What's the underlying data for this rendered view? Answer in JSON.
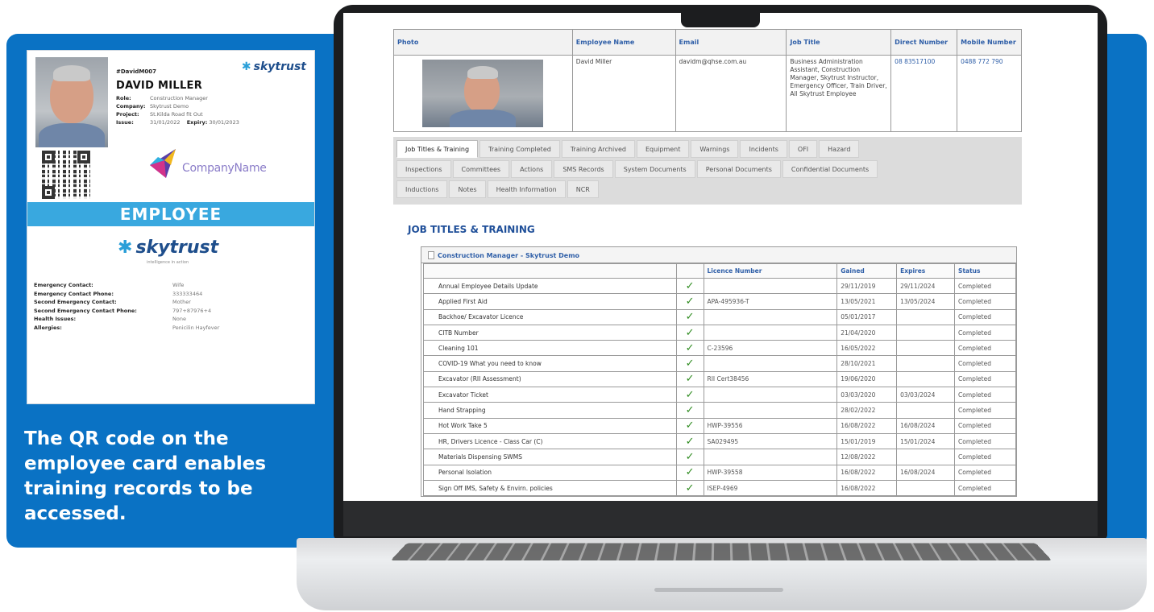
{
  "caption": "The QR code on the employee card enables training records to be accessed.",
  "colors": {
    "panel": "#0a72c4",
    "band": "#39a8df",
    "link": "#2f5fa8",
    "tick": "#2e8b1f"
  },
  "card": {
    "employee_id": "#DavidM007",
    "name": "DAVID MILLER",
    "brand": "skytrust",
    "fields": [
      {
        "label": "Role:",
        "value": "Construction Manager"
      },
      {
        "label": "Company:",
        "value": "Skytrust Demo"
      },
      {
        "label": "Project:",
        "value": "St.Kilda Road fit Out"
      }
    ],
    "issue_label": "Issue:",
    "issue": "31/01/2022",
    "expiry_label": "Expiry:",
    "expiry": "30/01/2023",
    "company_name": "CompanyName",
    "band_text": "EMPLOYEE",
    "brand_tagline": "intelligence in action",
    "emergency": [
      {
        "label": "Emergency Contact:",
        "value": "Wife"
      },
      {
        "label": "Emergency Contact Phone:",
        "value": "333333464"
      },
      {
        "label": "Second Emergency Contact:",
        "value": "Mother"
      },
      {
        "label": "Second Emergency Contact Phone:",
        "value": "797+87976+4"
      },
      {
        "label": "Health Issues:",
        "value": "None"
      },
      {
        "label": "Allergies:",
        "value": "Penicilin Hayfever"
      }
    ]
  },
  "employee_table": {
    "headers": [
      "Photo",
      "Employee Name",
      "Email",
      "Job Title",
      "Direct Number",
      "Mobile Number"
    ],
    "row": {
      "name": "David Miller",
      "email": "davidm@qhse.com.au",
      "job_title": "Business Administration Assistant, Construction Manager, Skytrust Instructor, Emergency Officer, Train Driver, All Skytrust Employee",
      "direct": "08 83517100",
      "mobile": "0488 772 790"
    }
  },
  "tabs": {
    "row1": [
      "Job Titles & Training",
      "Training Completed",
      "Training Archived",
      "Equipment",
      "Warnings",
      "Incidents",
      "OFI",
      "Hazard"
    ],
    "row2": [
      "Inspections",
      "Committees",
      "Actions",
      "SMS Records",
      "System Documents",
      "Personal Documents",
      "Confidential Documents"
    ],
    "row3": [
      "Inductions",
      "Notes",
      "Health Information",
      "NCR"
    ],
    "active": "Job Titles & Training"
  },
  "section_title": "JOB TITLES & TRAINING",
  "training": {
    "group_title": "Construction Manager - Skytrust Demo",
    "headers": [
      "",
      "",
      "Licence Number",
      "Gained",
      "Expires",
      "Status"
    ],
    "tick": "✓",
    "rows": [
      {
        "course": "Annual Employee Details Update",
        "licence": "",
        "gained": "29/11/2019",
        "expires": "29/11/2024",
        "status": "Completed"
      },
      {
        "course": "Applied First Aid",
        "licence": "APA-495936-T",
        "gained": "13/05/2021",
        "expires": "13/05/2024",
        "status": "Completed"
      },
      {
        "course": "Backhoe/ Excavator Licence",
        "licence": "",
        "gained": "05/01/2017",
        "expires": "",
        "status": "Completed"
      },
      {
        "course": "CITB Number",
        "licence": "",
        "gained": "21/04/2020",
        "expires": "",
        "status": "Completed"
      },
      {
        "course": "Cleaning 101",
        "licence": "C-23596",
        "gained": "16/05/2022",
        "expires": "",
        "status": "Completed"
      },
      {
        "course": "COVID-19 What you need to know",
        "licence": "",
        "gained": "28/10/2021",
        "expires": "",
        "status": "Completed"
      },
      {
        "course": "Excavator (RII Assessment)",
        "licence": "RII Cert38456",
        "gained": "19/06/2020",
        "expires": "",
        "status": "Completed"
      },
      {
        "course": "Excavator Ticket",
        "licence": "",
        "gained": "03/03/2020",
        "expires": "03/03/2024",
        "status": "Completed"
      },
      {
        "course": "Hand Strapping",
        "licence": "",
        "gained": "28/02/2022",
        "expires": "",
        "status": "Completed"
      },
      {
        "course": "Hot Work Take 5",
        "licence": "HWP-39556",
        "gained": "16/08/2022",
        "expires": "16/08/2024",
        "status": "Completed"
      },
      {
        "course": "HR, Drivers Licence - Class Car (C)",
        "licence": "SA029495",
        "gained": "15/01/2019",
        "expires": "15/01/2024",
        "status": "Completed"
      },
      {
        "course": "Materials Dispensing SWMS",
        "licence": "",
        "gained": "12/08/2022",
        "expires": "",
        "status": "Completed"
      },
      {
        "course": "Personal Isolation",
        "licence": "HWP-39558",
        "gained": "16/08/2022",
        "expires": "16/08/2024",
        "status": "Completed"
      },
      {
        "course": "Sign Off IMS, Safety & Envirn. policies",
        "licence": "ISEP-4969",
        "gained": "16/08/2022",
        "expires": "",
        "status": "Completed"
      }
    ]
  }
}
